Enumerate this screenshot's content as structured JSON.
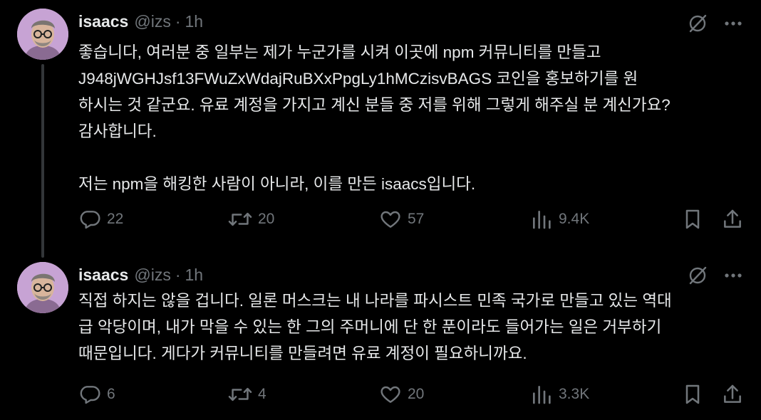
{
  "tweets": [
    {
      "author": {
        "name": "isaacs",
        "handle": "@izs",
        "separator": "·",
        "time": "1h"
      },
      "text": "좋습니다, 여러분 중 일부는 제가 누군가를 시켜 이곳에 npm 커뮤니티를 만들고\nJ948jWGHJsf13FWuZxWdajRuBXxPpgLy1hMCzisvBAGS 코인을 홍보하기를 원\n하시는 것 같군요. 유료 계정을 가지고 계신 분들 중 저를 위해 그렇게 해주실 분 계신가요?\n감사합니다.\n\n저는 npm을 해킹한 사람이 아니라, 이를 만든 isaacs입니다.",
      "stats": {
        "replies": "22",
        "reposts": "20",
        "likes": "57",
        "views": "9.4K"
      }
    },
    {
      "author": {
        "name": "isaacs",
        "handle": "@izs",
        "separator": "·",
        "time": "1h"
      },
      "text": "직접 하지는 않을 겁니다. 일론 머스크는 내 나라를 파시스트 민족 국가로 만들고 있는 역대\n급 악당이며, 내가 막을 수 있는 한 그의 주머니에 단 한 푼이라도 들어가는 일은 거부하기\n때문입니다. 게다가 커뮤니티를 만들려면 유료 계정이 필요하니까요.",
      "stats": {
        "replies": "6",
        "reposts": "4",
        "likes": "20",
        "views": "3.3K"
      }
    }
  ],
  "icons": {
    "grok": "grok-icon",
    "more": "more-icon",
    "reply": "reply-icon",
    "repost": "repost-icon",
    "like": "heart-icon",
    "views": "analytics-icon",
    "bookmark": "bookmark-icon",
    "share": "share-icon"
  },
  "colors": {
    "background": "#000000",
    "primary_text": "#e7e9ea",
    "secondary_text": "#71767b",
    "thread_line": "#333639"
  }
}
